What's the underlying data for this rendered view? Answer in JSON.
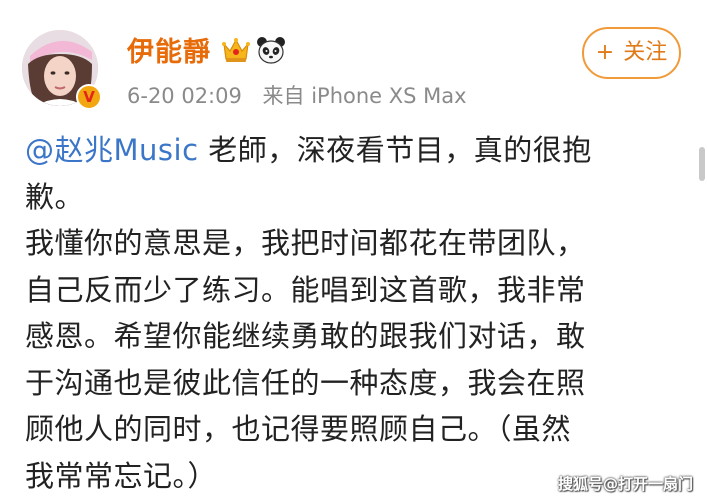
{
  "post": {
    "username": "伊能靜",
    "timestamp": "6-20 02:09",
    "source": "来自 iPhone XS Max",
    "follow_plus": "+",
    "follow_label": "关注",
    "verified_badge": "V",
    "username_color": "#e86b0a",
    "mention_color": "#3b76c8",
    "badge_icons": [
      "crown-icon",
      "panda-icon"
    ],
    "content": {
      "mention": "@赵兆Music",
      "line1_rest": " 老師，深夜看节目，真的很抱",
      "lines": [
        "歉。",
        "我懂你的意思是，我把时间都花在带团队，",
        "自己反而少了练习。能唱到这首歌，我非常",
        "感恩。希望你能继续勇敢的跟我们对话，敢",
        "于沟通也是彼此信任的一种态度，我会在照",
        "顾他人的同时，也记得要照顾自己。（虽然",
        "我常常忘记。）"
      ]
    }
  },
  "watermark": "搜狐号@打开一扇门"
}
